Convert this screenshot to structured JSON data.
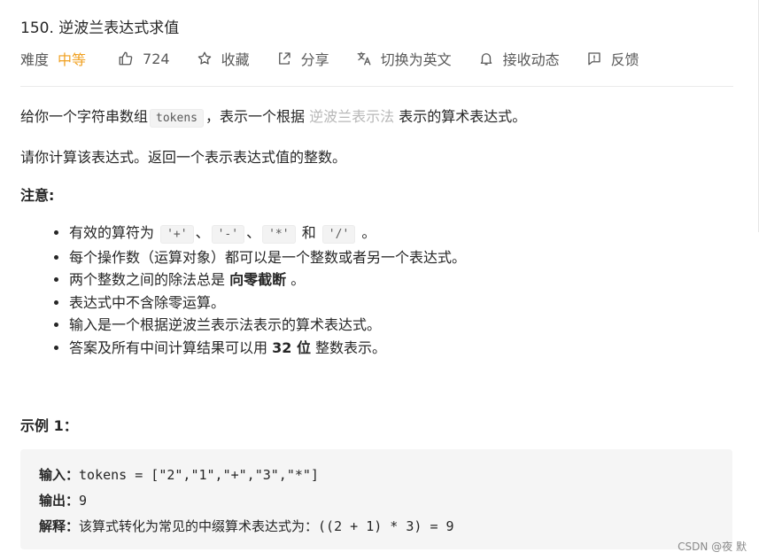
{
  "problem": {
    "title": "150. 逆波兰表达式求值",
    "difficulty_label": "难度",
    "difficulty_value": "中等",
    "like_count": "724",
    "actions": {
      "collect": "收藏",
      "share": "分享",
      "translate": "切换为英文",
      "subscribe": "接收动态",
      "feedback": "反馈"
    }
  },
  "description": {
    "p1_prefix": "给你一个字符串数组",
    "p1_code": "tokens",
    "p1_middle": "，表示一个根据",
    "p1_link": "逆波兰表示法",
    "p1_suffix": "表示的算术表达式。",
    "p2": "请你计算该表达式。返回一个表示表达式值的整数。"
  },
  "notes": {
    "title": "注意:",
    "item1_prefix": "有效的算符为",
    "op_plus": "'+'",
    "sep1": "、",
    "op_minus": "'-'",
    "sep2": "、",
    "op_mul": "'*'",
    "conj": "和",
    "op_div": "'/'",
    "item1_suffix": "。",
    "item2": "每个操作数（运算对象）都可以是一个整数或者另一个表达式。",
    "item3_prefix": "两个整数之间的除法总是",
    "item3_bold": "向零截断",
    "item3_suffix": "。",
    "item4": "表达式中不含除零运算。",
    "item5": "输入是一个根据逆波兰表示法表示的算术表达式。",
    "item6_prefix": "答案及所有中间计算结果可以用",
    "item6_bold": "32 位",
    "item6_suffix": "整数表示。"
  },
  "example": {
    "title": "示例 1：",
    "input_label": "输入：",
    "input_value": "tokens = [\"2\",\"1\",\"+\",\"3\",\"*\"]",
    "output_label": "输出：",
    "output_value": "9",
    "explain_label": "解释：",
    "explain_value": "该算式转化为常见的中缀算术表达式为：((2 + 1) * 3) = 9"
  },
  "watermark": "CSDN @夜 默",
  "colors": {
    "difficulty_medium": "#f0a020",
    "link_gray": "#b8b8b8",
    "example_bg": "#f5f5f5"
  }
}
